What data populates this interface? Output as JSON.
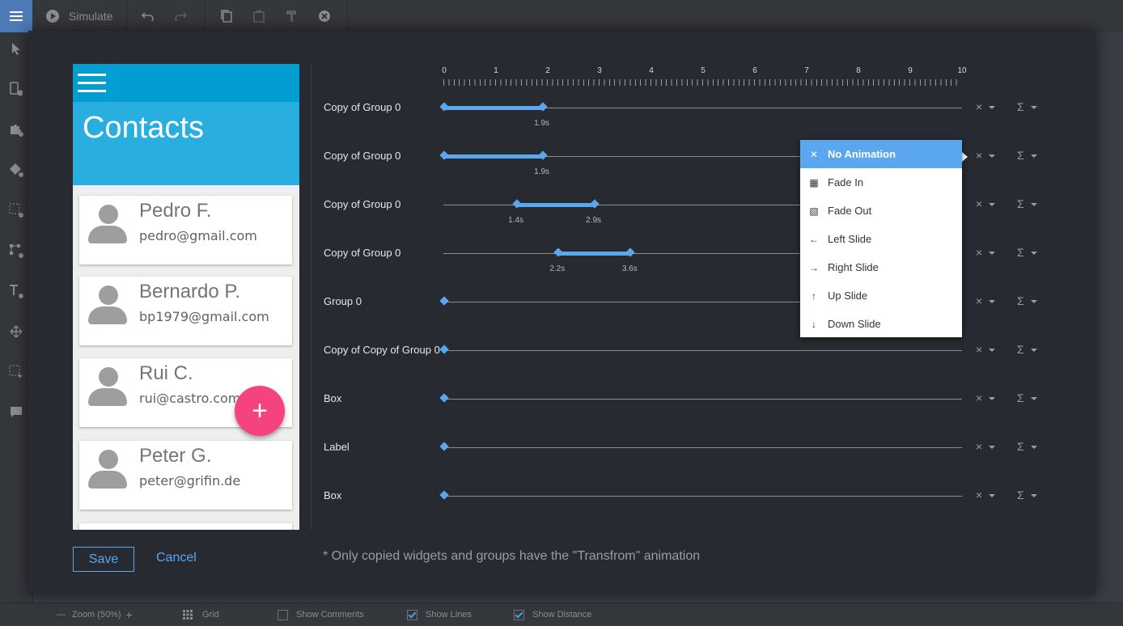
{
  "toolbar": {
    "simulate_label": "Simulate"
  },
  "statusbar": {
    "zoom_label": "Zoom (50%)",
    "grid_label": "Grid",
    "show_comments": "Show Comments",
    "show_lines": "Show Lines",
    "show_distance": "Show Distance",
    "show_comments_checked": false,
    "show_lines_checked": true,
    "show_distance_checked": true
  },
  "phone": {
    "title": "Contacts",
    "contacts": [
      {
        "name": "Pedro F.",
        "email": "pedro@gmail.com"
      },
      {
        "name": "Bernardo P.",
        "email": "bp1979@gmail.com"
      },
      {
        "name": "Rui C.",
        "email": "rui@castro.com"
      },
      {
        "name": "Peter G.",
        "email": "peter@grifin.de"
      }
    ],
    "fab_symbol": "+"
  },
  "actions": {
    "save": "Save",
    "cancel": "Cancel"
  },
  "note": "* Only copied widgets and groups have the \"Transfrom\" animation",
  "timeline": {
    "axis_labels": [
      "0",
      "1",
      "2",
      "3",
      "4",
      "5",
      "6",
      "7",
      "8",
      "9",
      "10"
    ],
    "rows": [
      {
        "label": "Copy of Group 0",
        "start": 0,
        "end": 1.9,
        "labels": [
          "1.9s"
        ]
      },
      {
        "label": "Copy of Group 0",
        "start": 0,
        "end": 1.9,
        "labels": [
          "1.9s"
        ]
      },
      {
        "label": "Copy of Group 0",
        "start": 1.4,
        "end": 2.9,
        "labels": [
          "1.4s",
          "2.9s"
        ]
      },
      {
        "label": "Copy of Group 0",
        "start": 2.2,
        "end": 3.6,
        "labels": [
          "2.2s",
          "3.6s"
        ]
      },
      {
        "label": "Group 0",
        "start": 0,
        "end": 0,
        "labels": []
      },
      {
        "label": "Copy of Copy of Group 0",
        "start": 0,
        "end": 0,
        "labels": []
      },
      {
        "label": "Box",
        "start": 0,
        "end": 0,
        "labels": []
      },
      {
        "label": "Label",
        "start": 0,
        "end": 0,
        "labels": []
      },
      {
        "label": "Box",
        "start": 0,
        "end": 0,
        "labels": []
      }
    ],
    "row_control_1": "×",
    "row_control_2": "Σ"
  },
  "animation_menu": {
    "items": [
      {
        "label": "No Animation",
        "icon": "close-icon",
        "glyph": "✕",
        "selected": true
      },
      {
        "label": "Fade In",
        "icon": "fade-in-icon",
        "glyph": "▦",
        "selected": false
      },
      {
        "label": "Fade Out",
        "icon": "fade-out-icon",
        "glyph": "▧",
        "selected": false
      },
      {
        "label": "Left Slide",
        "icon": "arrow-left-icon",
        "glyph": "←",
        "selected": false
      },
      {
        "label": "Right Slide",
        "icon": "arrow-right-icon",
        "glyph": "→",
        "selected": false
      },
      {
        "label": "Up Slide",
        "icon": "arrow-up-icon",
        "glyph": "↑",
        "selected": false
      },
      {
        "label": "Down Slide",
        "icon": "arrow-down-icon",
        "glyph": "↓",
        "selected": false
      }
    ]
  },
  "colors": {
    "accent": "#5aa6ef",
    "phone_header": "#29aee0",
    "fab": "#f5437f"
  }
}
